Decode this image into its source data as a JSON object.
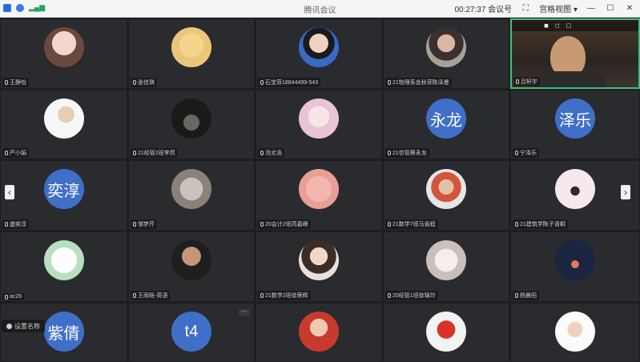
{
  "topbar": {
    "title": "腾讯会议",
    "status": "00:27:37 会议号",
    "view": "宫格视图"
  },
  "grid": {
    "tiles": [
      {
        "label": "王静怡",
        "avatar": "girl-illustration"
      },
      {
        "label": "张佳琪",
        "avatar": "cartoon-boy"
      },
      {
        "label": "石宝菲18844499-543",
        "avatar": "woman-photo"
      },
      {
        "label": "21物理系金秋菲陈泽曼",
        "avatar": "girl-photo"
      },
      {
        "label": "吕轩宇",
        "avatar": "",
        "speaker": true
      },
      {
        "label": "严小娟",
        "avatar": "boy-photo"
      },
      {
        "label": "21经管2班李然",
        "avatar": "dark-scene"
      },
      {
        "label": "汤尤浩",
        "avatar": "flower-girl"
      },
      {
        "label": "21信管蔡永龙",
        "avatar_text": "永龙"
      },
      {
        "label": "宁泽乐",
        "avatar_text": "泽乐"
      },
      {
        "label": "盛奕淳",
        "avatar_text": "奕淳"
      },
      {
        "label": "邹梦芹",
        "avatar": "arch-photo"
      },
      {
        "label": "20会计2班芮嘉嵘",
        "avatar": "pink-cartoon"
      },
      {
        "label": "21数学7班马竟程",
        "avatar": "sports-photo"
      },
      {
        "label": "21建筑学陈子语桐",
        "avatar": "pink-banner"
      },
      {
        "label": "ac26",
        "avatar": "white-bear"
      },
      {
        "label": "王雨晗-英语",
        "avatar": "man-glasses"
      },
      {
        "label": "21数学2班徐荣辉",
        "avatar": "girl-smile"
      },
      {
        "label": "20经管1班徐锦玲",
        "avatar": "white-flower"
      },
      {
        "label": "杨晨阳",
        "avatar": "night-city"
      },
      {
        "label": "",
        "avatar_text": "紫倩"
      },
      {
        "label": "",
        "avatar_text": "t4"
      },
      {
        "label": "",
        "avatar": "red-girl"
      },
      {
        "label": "",
        "avatar": "red-cartoon"
      },
      {
        "label": "",
        "avatar": "hat-woman"
      }
    ],
    "chip_label": "设置名称",
    "more_label": "···"
  },
  "nav": {
    "prev": "‹",
    "next": "›"
  },
  "colors": {
    "accent": "#3f6fc7",
    "speaker_border": "#3fbf78",
    "tile": "#2a2b2e"
  }
}
